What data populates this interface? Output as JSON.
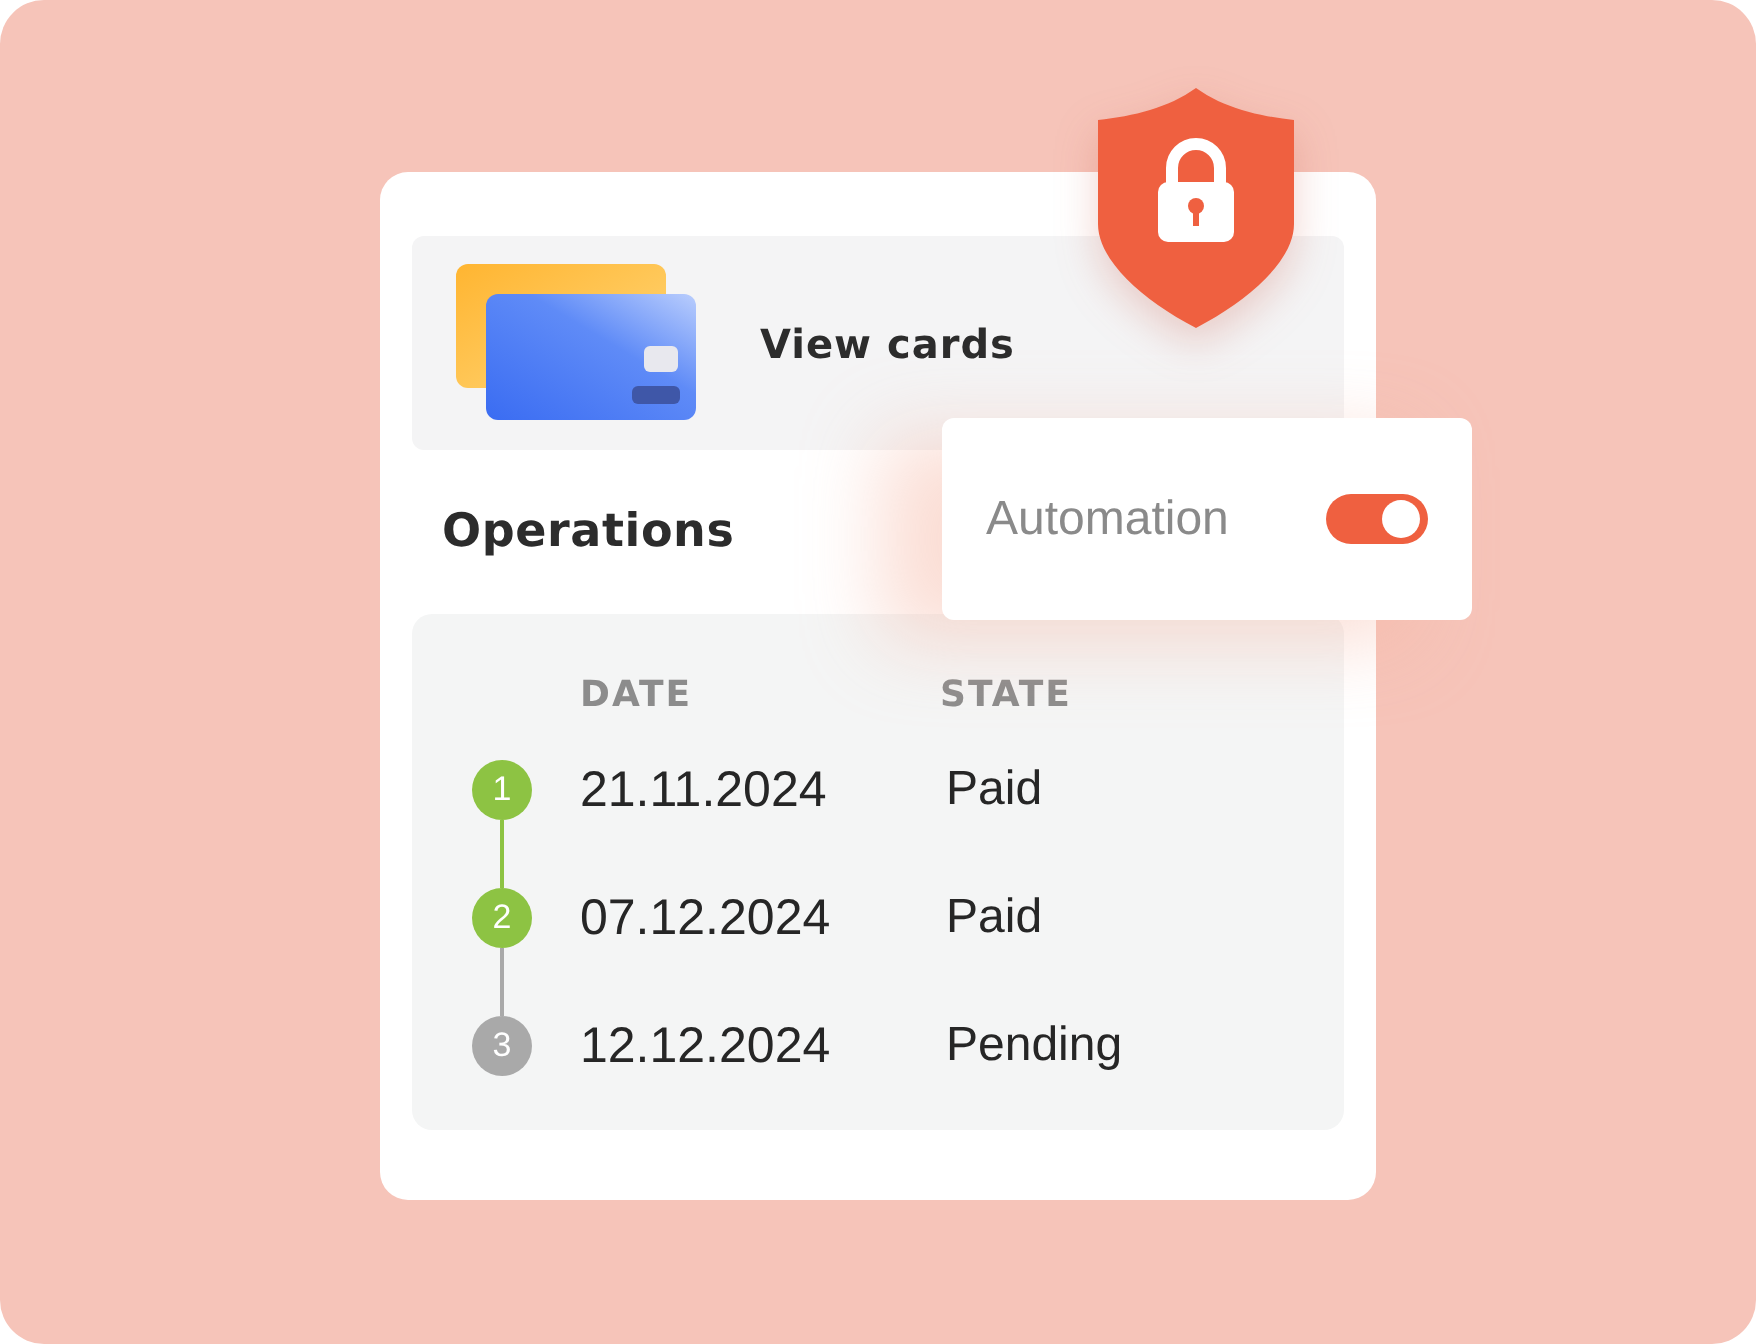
{
  "cards_panel": {
    "label": "View cards"
  },
  "operations": {
    "title": "Operations",
    "columns": [
      "DATE",
      "STATE"
    ],
    "rows": [
      {
        "step": "1",
        "completed": true,
        "date": "21.11.2024",
        "state": "Paid"
      },
      {
        "step": "2",
        "completed": true,
        "date": "07.12.2024",
        "state": "Paid"
      },
      {
        "step": "3",
        "completed": false,
        "date": "12.12.2024",
        "state": "Pending"
      }
    ]
  },
  "automation": {
    "label": "Automation",
    "on": true
  }
}
